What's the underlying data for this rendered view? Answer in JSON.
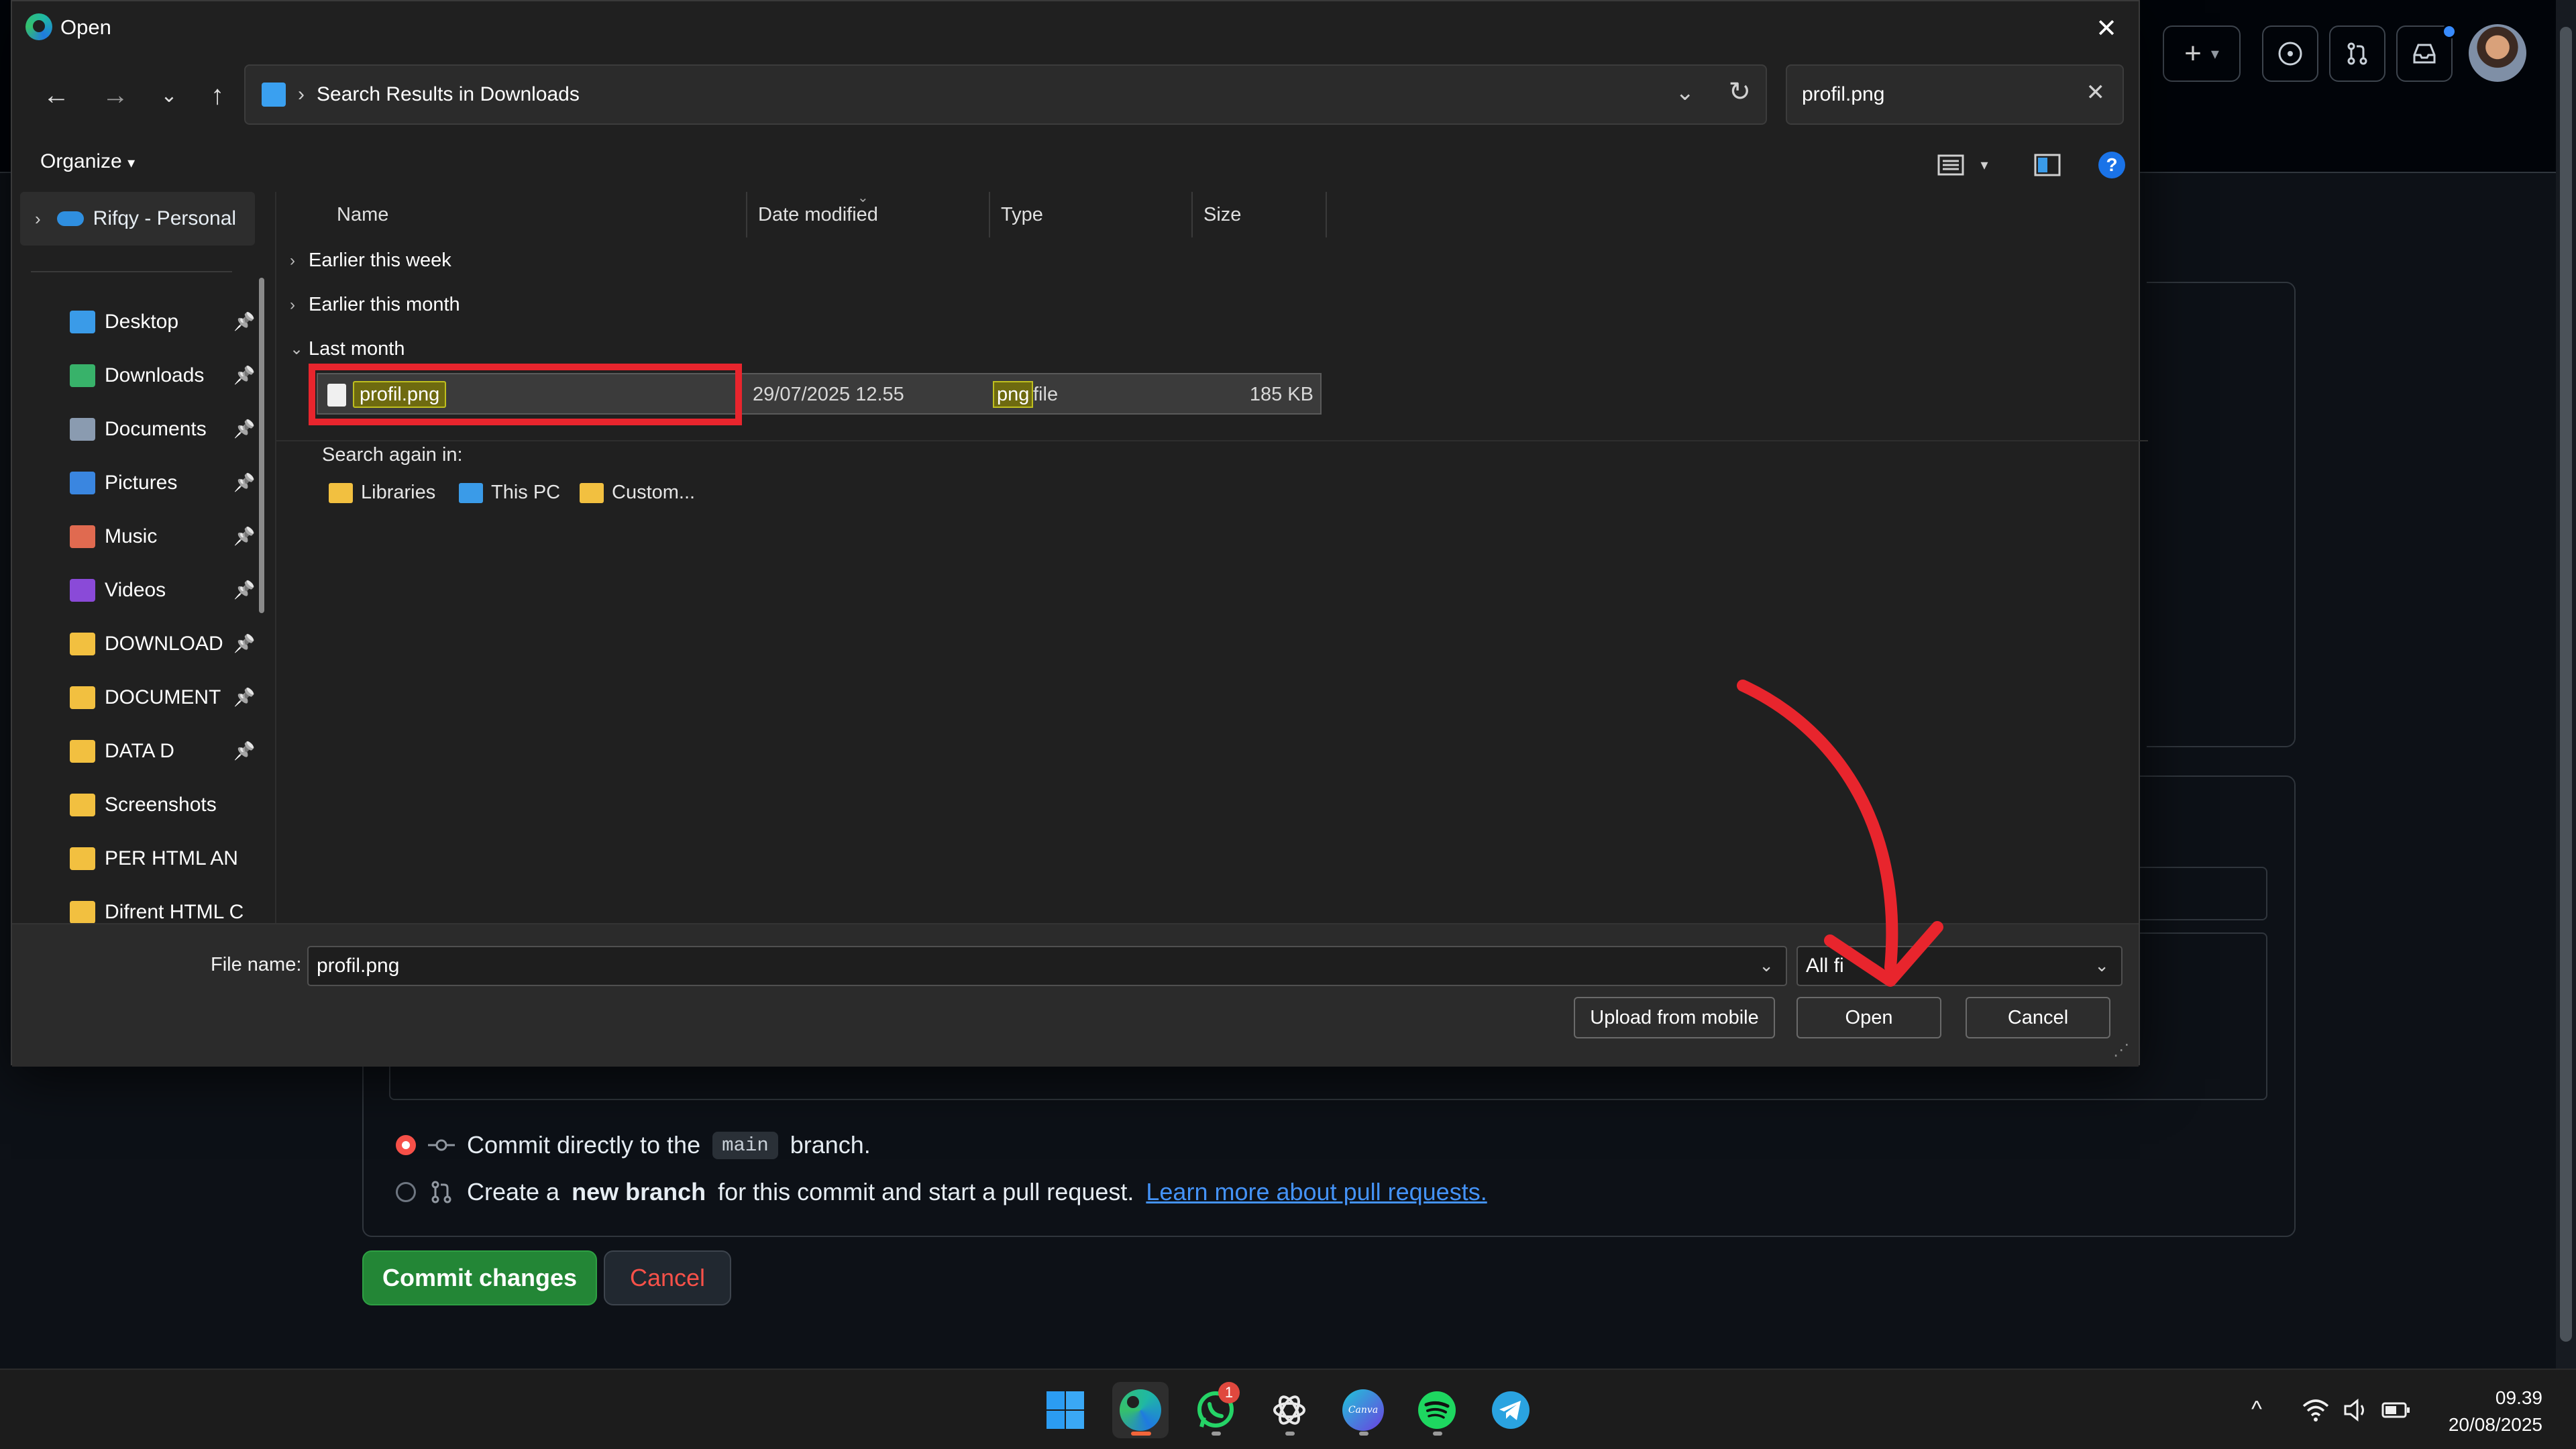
{
  "dialog": {
    "title": "Open",
    "address_path": "Search Results in Downloads",
    "search_value": "profil.png",
    "organize_label": "Organize",
    "columns": [
      "Name",
      "Date modified",
      "Type",
      "Size"
    ],
    "groups": [
      "Earlier this week",
      "Earlier this month",
      "Last month"
    ],
    "file": {
      "name": "profil.png",
      "date": "29/07/2025 12.55",
      "type_highlight": "png",
      "type_rest": " file",
      "size": "185 KB"
    },
    "search_again_label": "Search again in:",
    "search_again_items": [
      "Libraries",
      "This PC",
      "Custom..."
    ],
    "file_name_label": "File name:",
    "file_name_value": "profil.png",
    "filter_value": "All fi",
    "buttons": {
      "upload": "Upload from mobile",
      "open": "Open",
      "cancel": "Cancel"
    }
  },
  "nav": {
    "onedrive": "Rifqy - Personal",
    "items": [
      {
        "label": "Desktop",
        "icon": "desktop-icon",
        "color": "#3a9be8",
        "pinned": true
      },
      {
        "label": "Downloads",
        "icon": "download-icon",
        "color": "#38b26a",
        "pinned": true
      },
      {
        "label": "Documents",
        "icon": "document-icon",
        "color": "#8a9bb0",
        "pinned": true
      },
      {
        "label": "Pictures",
        "icon": "picture-icon",
        "color": "#3a86e0",
        "pinned": true
      },
      {
        "label": "Music",
        "icon": "music-icon",
        "color": "#e06a50",
        "pinned": true
      },
      {
        "label": "Videos",
        "icon": "video-icon",
        "color": "#8a4ad8",
        "pinned": true
      },
      {
        "label": "DOWNLOAD",
        "icon": "folder-icon",
        "color": "#f2c040",
        "pinned": true
      },
      {
        "label": "DOCUMENT",
        "icon": "folder-icon",
        "color": "#f2c040",
        "pinned": true
      },
      {
        "label": "DATA D",
        "icon": "folder-icon",
        "color": "#f2c040",
        "pinned": true
      },
      {
        "label": "Screenshots",
        "icon": "folder-icon",
        "color": "#f2c040",
        "pinned": false
      },
      {
        "label": "PER HTML AN",
        "icon": "folder-icon",
        "color": "#f2c040",
        "pinned": false
      },
      {
        "label": "Difrent HTML C",
        "icon": "folder-icon",
        "color": "#f2c040",
        "pinned": false
      }
    ]
  },
  "github": {
    "commit_direct_pre": "Commit directly to the",
    "branch": "main",
    "commit_direct_post": "branch.",
    "new_branch_pre": "Create a",
    "new_branch_bold": "new branch",
    "new_branch_post": "for this commit and start a pull request.",
    "learn_more": "Learn more about pull requests.",
    "commit_button": "Commit changes",
    "cancel_button": "Cancel"
  },
  "taskbar": {
    "whatsapp_badge": "1",
    "canva_label": "Canva",
    "time": "09.39",
    "date": "20/08/2025"
  },
  "colors": {
    "annotation_red": "#e8252d",
    "github_green": "#238636",
    "link_blue": "#4493f8"
  }
}
